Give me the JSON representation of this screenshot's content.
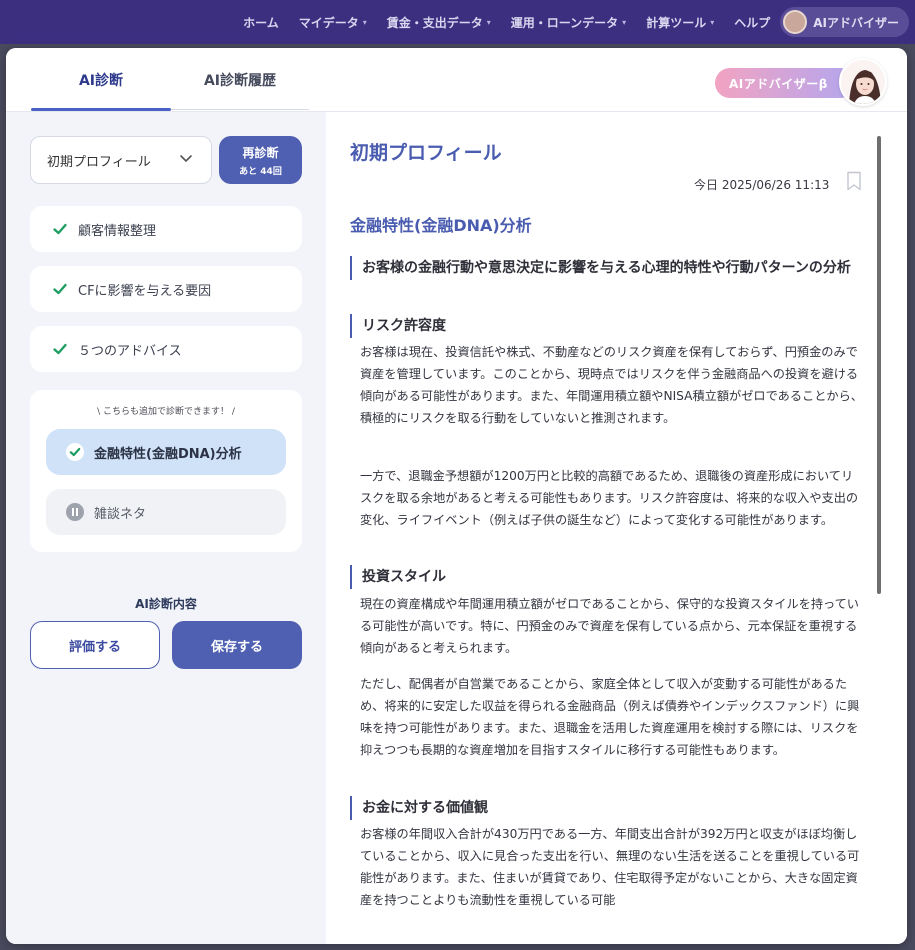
{
  "nav": {
    "items": [
      {
        "label": "ホーム",
        "caret": false
      },
      {
        "label": "マイデータ",
        "caret": true
      },
      {
        "label": "賃金・支出データ",
        "caret": true
      },
      {
        "label": "運用・ローンデータ",
        "caret": true
      },
      {
        "label": "計算ツール",
        "caret": true
      },
      {
        "label": "ヘルプ",
        "caret": false
      }
    ],
    "advisor_label": "AIアドバイザー"
  },
  "modal": {
    "tabs": {
      "diagnosis": "AI診断",
      "history": "AI診断履歴"
    },
    "advisor_badge": "AIアドバイザーβ"
  },
  "sidebar": {
    "profile_value": "初期プロフィール",
    "rediagnose": {
      "label": "再診断",
      "remaining": "あと 44回"
    },
    "steps": [
      "顧客情報整理",
      "CFに影響を与える要因",
      "５つのアドバイス"
    ],
    "extra_hint": "\\ こちらも追加で診断できます！ /",
    "extra_items": [
      {
        "label": "金融特性(金融DNA)分析",
        "selected": true
      },
      {
        "label": "雑談ネタ",
        "selected": false
      }
    ],
    "content_label": "AI診断内容",
    "evaluate_button": "評価する",
    "save_button": "保存する"
  },
  "content": {
    "title": "初期プロフィール",
    "timestamp": "今日 2025/06/26 11:13",
    "section_title": "金融特性(金融DNA)分析",
    "subsections": [
      {
        "heading": "お客様の金融行動や意思決定に影響を与える心理的特性や行動パターンの分析",
        "paragraphs": []
      },
      {
        "heading": "リスク許容度",
        "paragraphs": [
          "お客様は現在、投資信託や株式、不動産などのリスク資産を保有しておらず、円預金のみで資産を管理しています。このことから、現時点ではリスクを伴う金融商品への投資を避ける傾向がある可能性があります。また、年間運用積立額やNISA積立額がゼロであることから、積極的にリスクを取る行動をしていないと推測されます。",
          "一方で、退職金予想額が1200万円と比較的高額であるため、退職後の資産形成においてリスクを取る余地があると考える可能性もあります。リスク許容度は、将来的な収入や支出の変化、ライフイベント（例えば子供の誕生など）によって変化する可能性があります。"
        ]
      },
      {
        "heading": "投資スタイル",
        "paragraphs": [
          "現在の資産構成や年間運用積立額がゼロであることから、保守的な投資スタイルを持っている可能性が高いです。特に、円預金のみで資産を保有している点から、元本保証を重視する傾向があると考えられます。",
          "ただし、配偶者が自営業であることから、家庭全体として収入が変動する可能性があるため、将来的に安定した収益を得られる金融商品（例えば債券やインデックスファンド）に興味を持つ可能性があります。また、退職金を活用した資産運用を検討する際には、リスクを抑えつつも長期的な資産増加を目指すスタイルに移行する可能性もあります。"
        ]
      },
      {
        "heading": "お金に対する価値観",
        "paragraphs": [
          "お客様の年間収入合計が430万円である一方、年間支出合計が392万円と収支がほぼ均衡していることから、収入に見合った支出を行い、無理のない生活を送ることを重視している可能性があります。また、住まいが賃貸であり、住宅取得予定がないことから、大きな固定資産を持つことよりも流動性を重視している可能"
        ]
      }
    ]
  },
  "colors": {
    "nav_bg": "#3c2f80",
    "accent": "#4f5fb1",
    "heading": "#4a5cb0",
    "check": "#1f9e63"
  }
}
